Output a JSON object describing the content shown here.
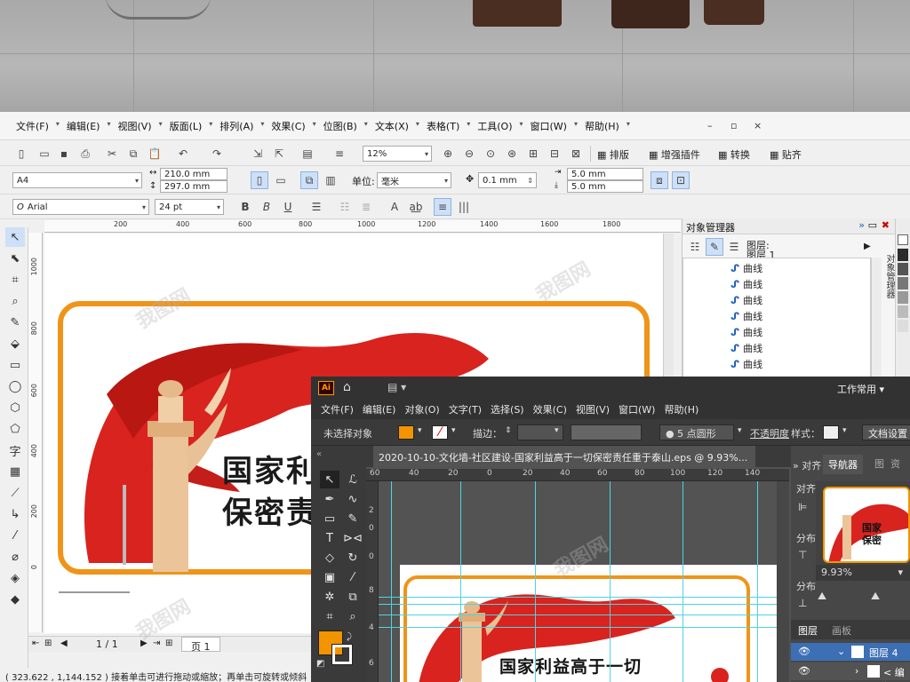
{
  "corel": {
    "menu": [
      "文件(F)",
      "编辑(E)",
      "视图(V)",
      "版面(L)",
      "排列(A)",
      "效果(C)",
      "位图(B)",
      "文本(X)",
      "表格(T)",
      "工具(O)",
      "窗口(W)",
      "帮助(H)"
    ],
    "window_controls": [
      "–",
      "▫",
      "×"
    ],
    "toolbar1": {
      "zoom": "12%",
      "plugin_buttons": [
        "排版",
        "增强插件",
        "转换",
        "贴齐"
      ]
    },
    "toolbar2": {
      "page_size": "A4",
      "width": "210.0 mm",
      "height": "297.0 mm",
      "unit_label": "单位:",
      "unit_value": "毫米",
      "nudge": "0.1 mm",
      "dup_x": "5.0 mm",
      "dup_y": "5.0 mm"
    },
    "toolbar3": {
      "font": "Arial",
      "font_size": "24 pt"
    },
    "ruler_top_ticks": [
      "200",
      "400",
      "600",
      "800",
      "1000",
      "1200",
      "1400",
      "1600",
      "1800"
    ],
    "ruler_left_ticks": [
      "1000",
      "800",
      "600",
      "400",
      "200",
      "0"
    ],
    "art_text": [
      "国家利",
      "保密责"
    ],
    "object_manager": {
      "title": "对象管理器",
      "layer_label": "图层:",
      "layer_name": "图层 1",
      "items": [
        "曲线",
        "曲线",
        "曲线",
        "曲线",
        "曲线",
        "曲线",
        "曲线"
      ],
      "side_tab": "对象管理器"
    },
    "side_tab2": "变换",
    "page_nav": {
      "count": "1 / 1",
      "tab": "页 1"
    },
    "status": "( 323.622 , 1,144.152 )  接着单击可进行拖动或缩放；再单击可旋转或倾斜"
  },
  "ai": {
    "logo": "Ai",
    "workspace": "工作常用",
    "menu": [
      "文件(F)",
      "编辑(E)",
      "对象(O)",
      "文字(T)",
      "选择(S)",
      "效果(C)",
      "视图(V)",
      "窗口(W)",
      "帮助(H)"
    ],
    "control": {
      "no_selection": "未选择对象",
      "stroke_label": "描边：",
      "brush": "5 点圆形",
      "opacity": "不透明度",
      "style": "样式：",
      "doc_settings": "文档设置"
    },
    "doc_tab": "2020-10-10-文化墙-社区建设-国家利益高于一切保密责任重于泰山.eps @ 9.93%...",
    "ruler_top": [
      "60",
      "40",
      "20",
      "0",
      "20",
      "40",
      "60",
      "80",
      "100",
      "120",
      "140"
    ],
    "ruler_left": [
      "2",
      "0",
      "0",
      "8",
      "4",
      "6"
    ],
    "art_text": "国家利益高于一切",
    "panels": {
      "align_tab": "对齐",
      "nav_tab": "导航器",
      "align_label": "对齐",
      "dist_label": "分布",
      "dist_label2": "分布",
      "zoom": "9.93%",
      "layers_tab": "图层",
      "artboards_tab": "画板",
      "layer4": "图层 4",
      "sub_item": "< 编辑"
    },
    "preview_text": [
      "国家",
      "保密"
    ],
    "accent": "#f29400"
  },
  "watermark": "我图网"
}
